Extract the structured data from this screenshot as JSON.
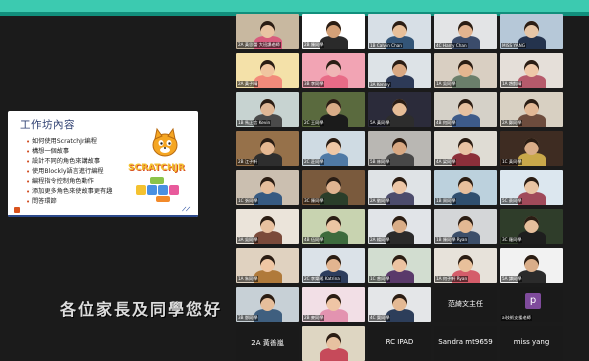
{
  "slide": {
    "title": "工作坊內容",
    "bullets": [
      "如何使用ScratchJr編程",
      "構想一個故事",
      "設計不同的角色來講故事",
      "使用Blockly語言進行編程",
      "編程指令控制角色動作",
      "添加更多角色來使故事更有趣",
      "問答環節"
    ],
    "logo_text": "SCRATCHJR"
  },
  "tiles": [
    {
      "name": "2A 黃思蕾 大班課老師",
      "bg": "#c8b8a0",
      "face": "#e9c4a2",
      "body": "#d85b7c"
    },
    {
      "name": "2B 陳同學",
      "bg": "#ffffff",
      "face": "#d4a077",
      "body": "#2a2a2a"
    },
    {
      "name": "1B Calvin Chan",
      "bg": "#d7dfe6",
      "face": "#e8c09a",
      "body": "#335577"
    },
    {
      "name": "4C Harry Chan",
      "bg": "#e3e4e6",
      "face": "#e2b38f",
      "body": "#3b4c6b"
    },
    {
      "name": "MISS YANG",
      "bg": "#b6c8d8",
      "face": "#e7c6a6",
      "body": "#24334d"
    },
    {
      "name": "2A 黃子晴",
      "bg": "#f4e1a9",
      "face": "#f0c5a0",
      "body": "#f28a7a"
    },
    {
      "name": "3B 李同學",
      "bg": "#f2a4b4",
      "face": "#f0b6b6",
      "body": "#e86b87"
    },
    {
      "name": "3A Kenny",
      "bg": "#dde3e7",
      "face": "#d9a882",
      "body": "#2d3a57"
    },
    {
      "name": "1A 吳同學",
      "bg": "#d9cfc2",
      "face": "#e4b690",
      "body": "#6b7f6b"
    },
    {
      "name": "1A 趙凱晴",
      "bg": "#e5dfd9",
      "face": "#efc8a8",
      "body": "#b65a6b"
    },
    {
      "name": "1B 馬正言 Kevin",
      "bg": "#c7d3d1",
      "face": "#e0b795",
      "body": "#4a4a4a"
    },
    {
      "name": "2C 王同學",
      "bg": "#5a6a3e",
      "face": "#d8ab87",
      "body": "#1b1b1b"
    },
    {
      "name": "5A 黃同學",
      "bg": "#2b2b3a",
      "face": "#e6bd97",
      "body": "#2d2d2d"
    },
    {
      "name": "4B 何同學",
      "bg": "#d5d1c8",
      "face": "#e6c1a0",
      "body": "#3d5b8a"
    },
    {
      "name": "2A 鄭同學",
      "bg": "#d8d0c2",
      "face": "#e2b895",
      "body": "#6d4c3d"
    },
    {
      "name": "2B 江子軒",
      "bg": "#96714a",
      "face": "#e5b892",
      "body": "#2e2e2e"
    },
    {
      "name": "2C 莊同學",
      "bg": "#cfdbe3",
      "face": "#efc7a5",
      "body": "#4f7aa6"
    },
    {
      "name": "5B 林同學",
      "bg": "#b9b7b3",
      "face": "#d8a882",
      "body": "#484848"
    },
    {
      "name": "4A 梁同學",
      "bg": "#dfdcd4",
      "face": "#e9c3a3",
      "body": "#8c2f3a"
    },
    {
      "name": "1C 黃同學",
      "bg": "#3e2c22",
      "face": "#d9ad88",
      "body": "#c9a84a"
    },
    {
      "name": "1C 張同學",
      "bg": "#cbbfb0",
      "face": "#e6be9c",
      "body": "#365a82"
    },
    {
      "name": "3C 陳同學",
      "bg": "#7a5a3d",
      "face": "#e0b491",
      "body": "#2a3e2a"
    },
    {
      "name": "2A 劉同學",
      "bg": "#dfe3e6",
      "face": "#ecc6a6",
      "body": "#4c4c6c"
    },
    {
      "name": "1B 周同學",
      "bg": "#bcd1dd",
      "face": "#e7bf9c",
      "body": "#2f4f6f"
    },
    {
      "name": "5C 蔡同學",
      "bg": "#dce7ef",
      "face": "#e9c4a2",
      "body": "#a04a5a"
    },
    {
      "name": "3A 吳同學",
      "bg": "#ebe4da",
      "face": "#e8c19f",
      "body": "#7a4a3a"
    },
    {
      "name": "4B 伍同學",
      "bg": "#c8d3b0",
      "face": "#eac5a3",
      "body": "#3d6b3d"
    },
    {
      "name": "2A 楊同學",
      "bg": "#e1e4e8",
      "face": "#d9ad87",
      "body": "#2a2a2a"
    },
    {
      "name": "1B 陳同學 Ryan",
      "bg": "#d4d6d8",
      "face": "#e2b893",
      "body": "#3c4f6a"
    },
    {
      "name": "3C 羅同學",
      "bg": "#2f3d2a",
      "face": "#e6bf9c",
      "body": "#1e1e1e"
    },
    {
      "name": "1A 朱同學",
      "bg": "#e0d2c0",
      "face": "#efc7a4",
      "body": "#b07a3a"
    },
    {
      "name": "2C 李樂瑤 Katrina",
      "bg": "#dbe2e8",
      "face": "#e2b590",
      "body": "#2d3d5d"
    },
    {
      "name": "1C 曾同學",
      "bg": "#d2ddd0",
      "face": "#ebc3a1",
      "body": "#5a3a6a"
    },
    {
      "name": "1A 何子軒 Ryan",
      "bg": "#e7e2da",
      "face": "#e8c09b",
      "body": "#d45d6a"
    },
    {
      "name": "5A 譚同學",
      "bg": "#f2f2f2",
      "face": "#d9ad89",
      "body": "#2b2b2b"
    },
    {
      "name": "3B 鄧同學",
      "bg": "#c7d0d6",
      "face": "#e6be9b",
      "body": "#3f5f7f"
    },
    {
      "name": "2B 麥同學",
      "bg": "#f2dfe6",
      "face": "#efc5a5",
      "body": "#e393b0"
    },
    {
      "name": "4C 葉同學",
      "bg": "#e4e6e8",
      "face": "#e3b994",
      "body": "#2d3e5a"
    },
    {
      "name": "范綺文主任",
      "bg": "#1a1a1a",
      "face": "#1a1a1a",
      "body": "#1a1a1a",
      "name_only": true
    },
    {
      "name": "ai技術支援老師",
      "bg": "#1a1a1a",
      "face": "#1a1a1a",
      "body": "#1a1a1a",
      "avatar": "p"
    },
    {
      "name": "2A 黃善嵐",
      "bg": "#1a1a1a",
      "name_only": true
    },
    {
      "name": "",
      "bg": "#ded6c2",
      "face": "#e7c1a0",
      "body": "#c64a5a"
    },
    {
      "name": "RC IPAD",
      "bg": "#1a1a1a",
      "name_only": true
    },
    {
      "name": "Sandra mt9659",
      "bg": "#1a1a1a",
      "name_only": true
    },
    {
      "name": "miss yang",
      "bg": "#1a1a1a",
      "name_only": true
    }
  ],
  "subtitle": "各位家長及同學您好"
}
